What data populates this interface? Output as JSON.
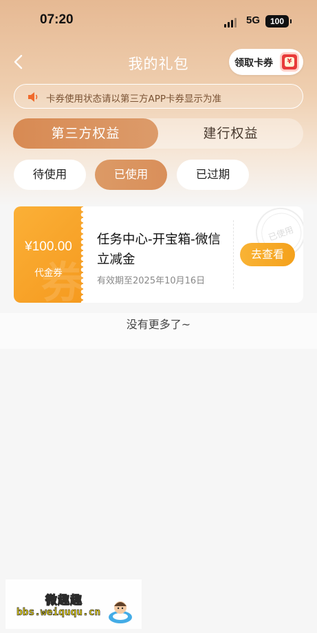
{
  "status_bar": {
    "time": "07:20",
    "network": "5G",
    "battery": "100"
  },
  "nav": {
    "title": "我的礼包",
    "claim_button": "领取卡券",
    "back_icon": "chevron-left-icon"
  },
  "notice": {
    "icon": "speaker-icon",
    "text": "卡券使用状态请以第三方APP卡券显示为准"
  },
  "main_tabs": [
    {
      "label": "第三方权益",
      "active": true
    },
    {
      "label": "建行权益",
      "active": false
    }
  ],
  "filter_tabs": [
    {
      "label": "待使用",
      "active": false
    },
    {
      "label": "已使用",
      "active": true
    },
    {
      "label": "已过期",
      "active": false
    }
  ],
  "coupons": [
    {
      "amount": "¥100.00",
      "type": "代金券",
      "title": "任务中心-开宝箱-微信立减金",
      "expiry": "有效期至2025年10月16日",
      "action": "去查看",
      "stamp": "已使用"
    }
  ],
  "end_message": "没有更多了~",
  "site_watermark": {
    "name": "微趣趣",
    "url": "bbs.weiququ.cn"
  },
  "colors": {
    "accent_orange": "#f4a11c",
    "tab_active": "#d88a53",
    "header_gradient_top": "#e6b993"
  }
}
